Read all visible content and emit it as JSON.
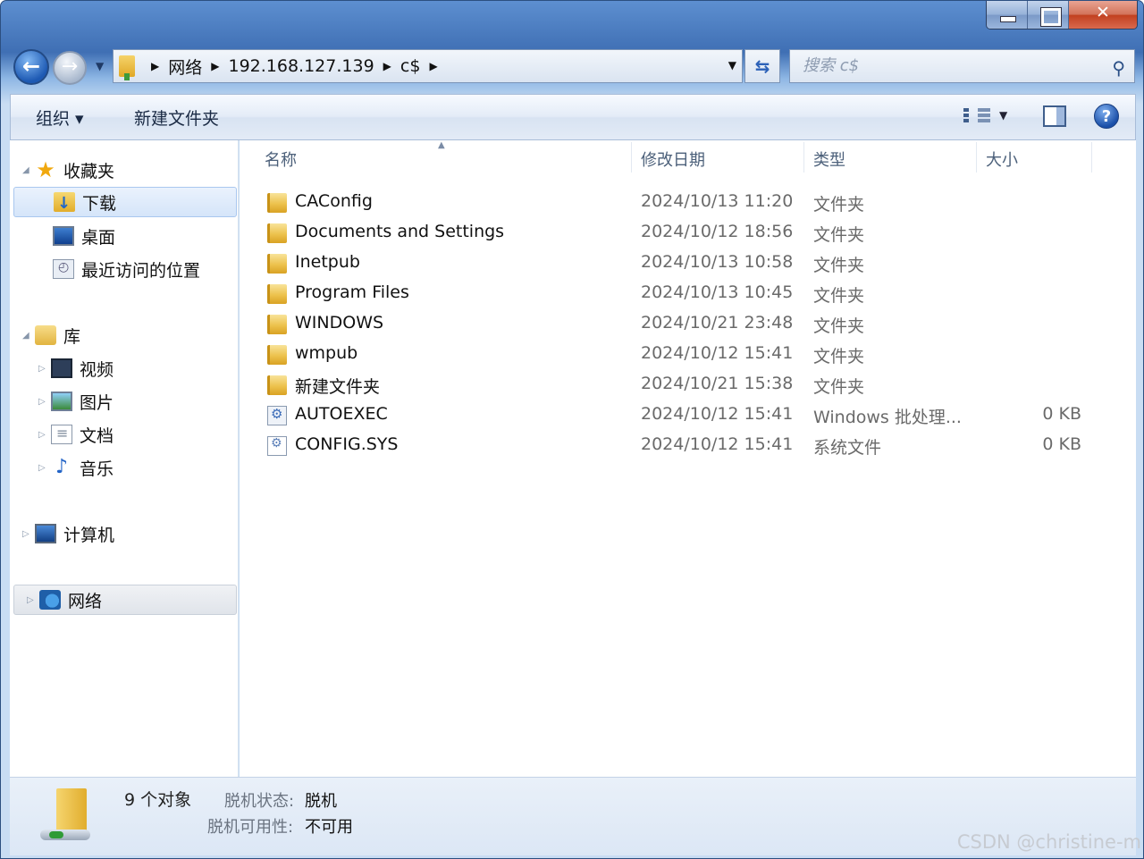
{
  "nav": {
    "breadcrumbs": [
      "网络",
      "192.168.127.139",
      "c$"
    ],
    "search_placeholder": "搜索 c$"
  },
  "toolbar": {
    "organize": "组织 ▾",
    "new_folder": "新建文件夹"
  },
  "sidebar": {
    "favorites": "收藏夹",
    "downloads": "下载",
    "desktop": "桌面",
    "recent": "最近访问的位置",
    "libraries": "库",
    "videos": "视频",
    "pictures": "图片",
    "documents": "文档",
    "music": "音乐",
    "computer": "计算机",
    "network": "网络"
  },
  "columns": {
    "name": "名称",
    "modified": "修改日期",
    "type": "类型",
    "size": "大小"
  },
  "files": [
    {
      "name": "CAConfig",
      "date": "2024/10/13 11:20",
      "type": "文件夹",
      "size": "",
      "icon": "folder"
    },
    {
      "name": "Documents and Settings",
      "date": "2024/10/12 18:56",
      "type": "文件夹",
      "size": "",
      "icon": "folder"
    },
    {
      "name": "Inetpub",
      "date": "2024/10/13 10:58",
      "type": "文件夹",
      "size": "",
      "icon": "folder"
    },
    {
      "name": "Program Files",
      "date": "2024/10/13 10:45",
      "type": "文件夹",
      "size": "",
      "icon": "folder"
    },
    {
      "name": "WINDOWS",
      "date": "2024/10/21 23:48",
      "type": "文件夹",
      "size": "",
      "icon": "folder"
    },
    {
      "name": "wmpub",
      "date": "2024/10/12 15:41",
      "type": "文件夹",
      "size": "",
      "icon": "folder"
    },
    {
      "name": "新建文件夹",
      "date": "2024/10/21 15:38",
      "type": "文件夹",
      "size": "",
      "icon": "folder"
    },
    {
      "name": "AUTOEXEC",
      "date": "2024/10/12 15:41",
      "type": "Windows 批处理...",
      "size": "0 KB",
      "icon": "batch-file"
    },
    {
      "name": "CONFIG.SYS",
      "date": "2024/10/12 15:41",
      "type": "系统文件",
      "size": "0 KB",
      "icon": "system-file"
    }
  ],
  "status": {
    "count": "9 个对象",
    "offline_status_label": "脱机状态:",
    "offline_status_value": "脱机",
    "offline_avail_label": "脱机可用性:",
    "offline_avail_value": "不可用"
  },
  "watermark": "CSDN @christine-m"
}
